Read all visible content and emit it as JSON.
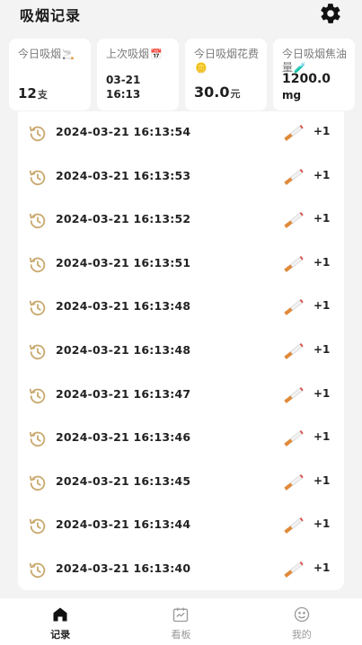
{
  "header": {
    "title": "吸烟记录"
  },
  "stats": [
    {
      "label": "今日吸烟",
      "emoji": "🚬",
      "value": "12",
      "unit": "支"
    },
    {
      "label": "上次吸烟",
      "emoji": "📅",
      "value_line1": "03-21",
      "value_line2": "16:13"
    },
    {
      "label": "今日吸烟花费",
      "emoji": "🪙",
      "value": "30.0",
      "unit": "元"
    },
    {
      "label": "今日吸烟焦油量",
      "emoji": "🧪",
      "value_line1": "1200.0",
      "value_line2": "mg"
    }
  ],
  "records": [
    {
      "time": "2024-03-21 16:13:54",
      "count": "+1"
    },
    {
      "time": "2024-03-21 16:13:53",
      "count": "+1"
    },
    {
      "time": "2024-03-21 16:13:52",
      "count": "+1"
    },
    {
      "time": "2024-03-21 16:13:51",
      "count": "+1"
    },
    {
      "time": "2024-03-21 16:13:48",
      "count": "+1"
    },
    {
      "time": "2024-03-21 16:13:48",
      "count": "+1"
    },
    {
      "time": "2024-03-21 16:13:47",
      "count": "+1"
    },
    {
      "time": "2024-03-21 16:13:46",
      "count": "+1"
    },
    {
      "time": "2024-03-21 16:13:45",
      "count": "+1"
    },
    {
      "time": "2024-03-21 16:13:44",
      "count": "+1"
    },
    {
      "time": "2024-03-21 16:13:40",
      "count": "+1"
    }
  ],
  "tabs": [
    {
      "label": "记录",
      "icon": "home-icon",
      "active": true
    },
    {
      "label": "看板",
      "icon": "calendar-icon",
      "active": false
    },
    {
      "label": "我的",
      "icon": "smiley-icon",
      "active": false
    }
  ],
  "colors": {
    "accent": "#c9a96e",
    "active_tab": "#222222"
  }
}
